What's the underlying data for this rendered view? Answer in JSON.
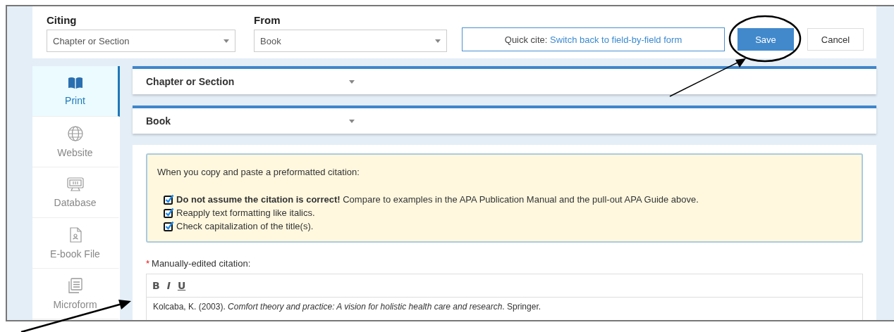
{
  "top_bar": {
    "citing": {
      "label": "Citing",
      "value": "Chapter or Section"
    },
    "from": {
      "label": "From",
      "value": "Book"
    },
    "quick_cite": {
      "label": "Quick cite:",
      "link": "Switch back to field-by-field form"
    },
    "buttons": [
      {
        "label": "Save",
        "kind": "primary"
      },
      {
        "label": "Cancel",
        "kind": "secondary"
      }
    ]
  },
  "sidebar": {
    "items": [
      {
        "label": "Print",
        "kind": "print",
        "selected": true
      },
      {
        "label": "Website",
        "kind": "website",
        "selected": false
      },
      {
        "label": "Database",
        "kind": "database",
        "selected": false
      },
      {
        "label": "E-book File",
        "kind": "ebook",
        "selected": false
      },
      {
        "label": "Microform",
        "kind": "microform",
        "selected": false
      }
    ]
  },
  "sections": [
    {
      "title": "Chapter or Section"
    },
    {
      "title": "Book"
    }
  ],
  "notice": {
    "intro": "When you copy and paste a preformatted citation:",
    "items": [
      {
        "text": "**Do not assume the citation is correct!** Compare to examples in the APA Publication Manual and the pull-out APA Guide above.",
        "checked": true
      },
      {
        "text": "Reapply text formatting like italics.",
        "checked": true
      },
      {
        "text": "Check capitalization of the title(s).",
        "checked": true
      }
    ]
  },
  "citation_field": {
    "required_mark": "*",
    "label": "Manually-edited citation:",
    "toolbar": [
      "B",
      "I",
      "U"
    ],
    "value": "Kolcaba, K. (2003). *Comfort theory and practice: A vision for holistic health care and research*. Springer."
  }
}
